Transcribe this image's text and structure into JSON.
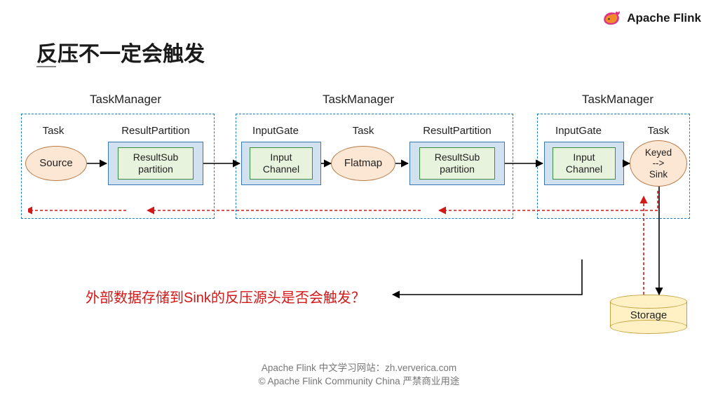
{
  "brand": {
    "name": "Apache Flink"
  },
  "title": "反压不一定会触发",
  "tm_labels": {
    "a": "TaskManager",
    "b": "TaskManager",
    "c": "TaskManager"
  },
  "labels": {
    "task": "Task",
    "result_partition": "ResultPartition",
    "input_gate": "InputGate"
  },
  "nodes": {
    "source": "Source",
    "rsp1": "ResultSub\npartition",
    "ic1": "Input\nChannel",
    "flatmap": "Flatmap",
    "rsp2": "ResultSub\npartition",
    "ic2": "Input\nChannel",
    "keyed_sink": "Keyed\n-->\nSink",
    "storage": "Storage"
  },
  "question": "外部数据存储到Sink的反压源头是否会触发？",
  "footer": {
    "line1": "Apache Flink 中文学习网站：zh.ververica.com",
    "line2": "© Apache Flink Community China  严禁商业用途"
  },
  "colors": {
    "tm_border": "#1a7fc6",
    "ellipse_fill": "#fce6d4",
    "ellipse_stroke": "#b87c4a",
    "bluebox_fill": "#d1e1ef",
    "bluebox_stroke": "#3a77b5",
    "greenbox_fill": "#e8f3dd",
    "greenbox_stroke": "#3e8a3e",
    "storage_fill": "#fff1c4",
    "storage_stroke": "#c2a23e",
    "arrow": "#000000",
    "backpressure": "#d31818"
  }
}
